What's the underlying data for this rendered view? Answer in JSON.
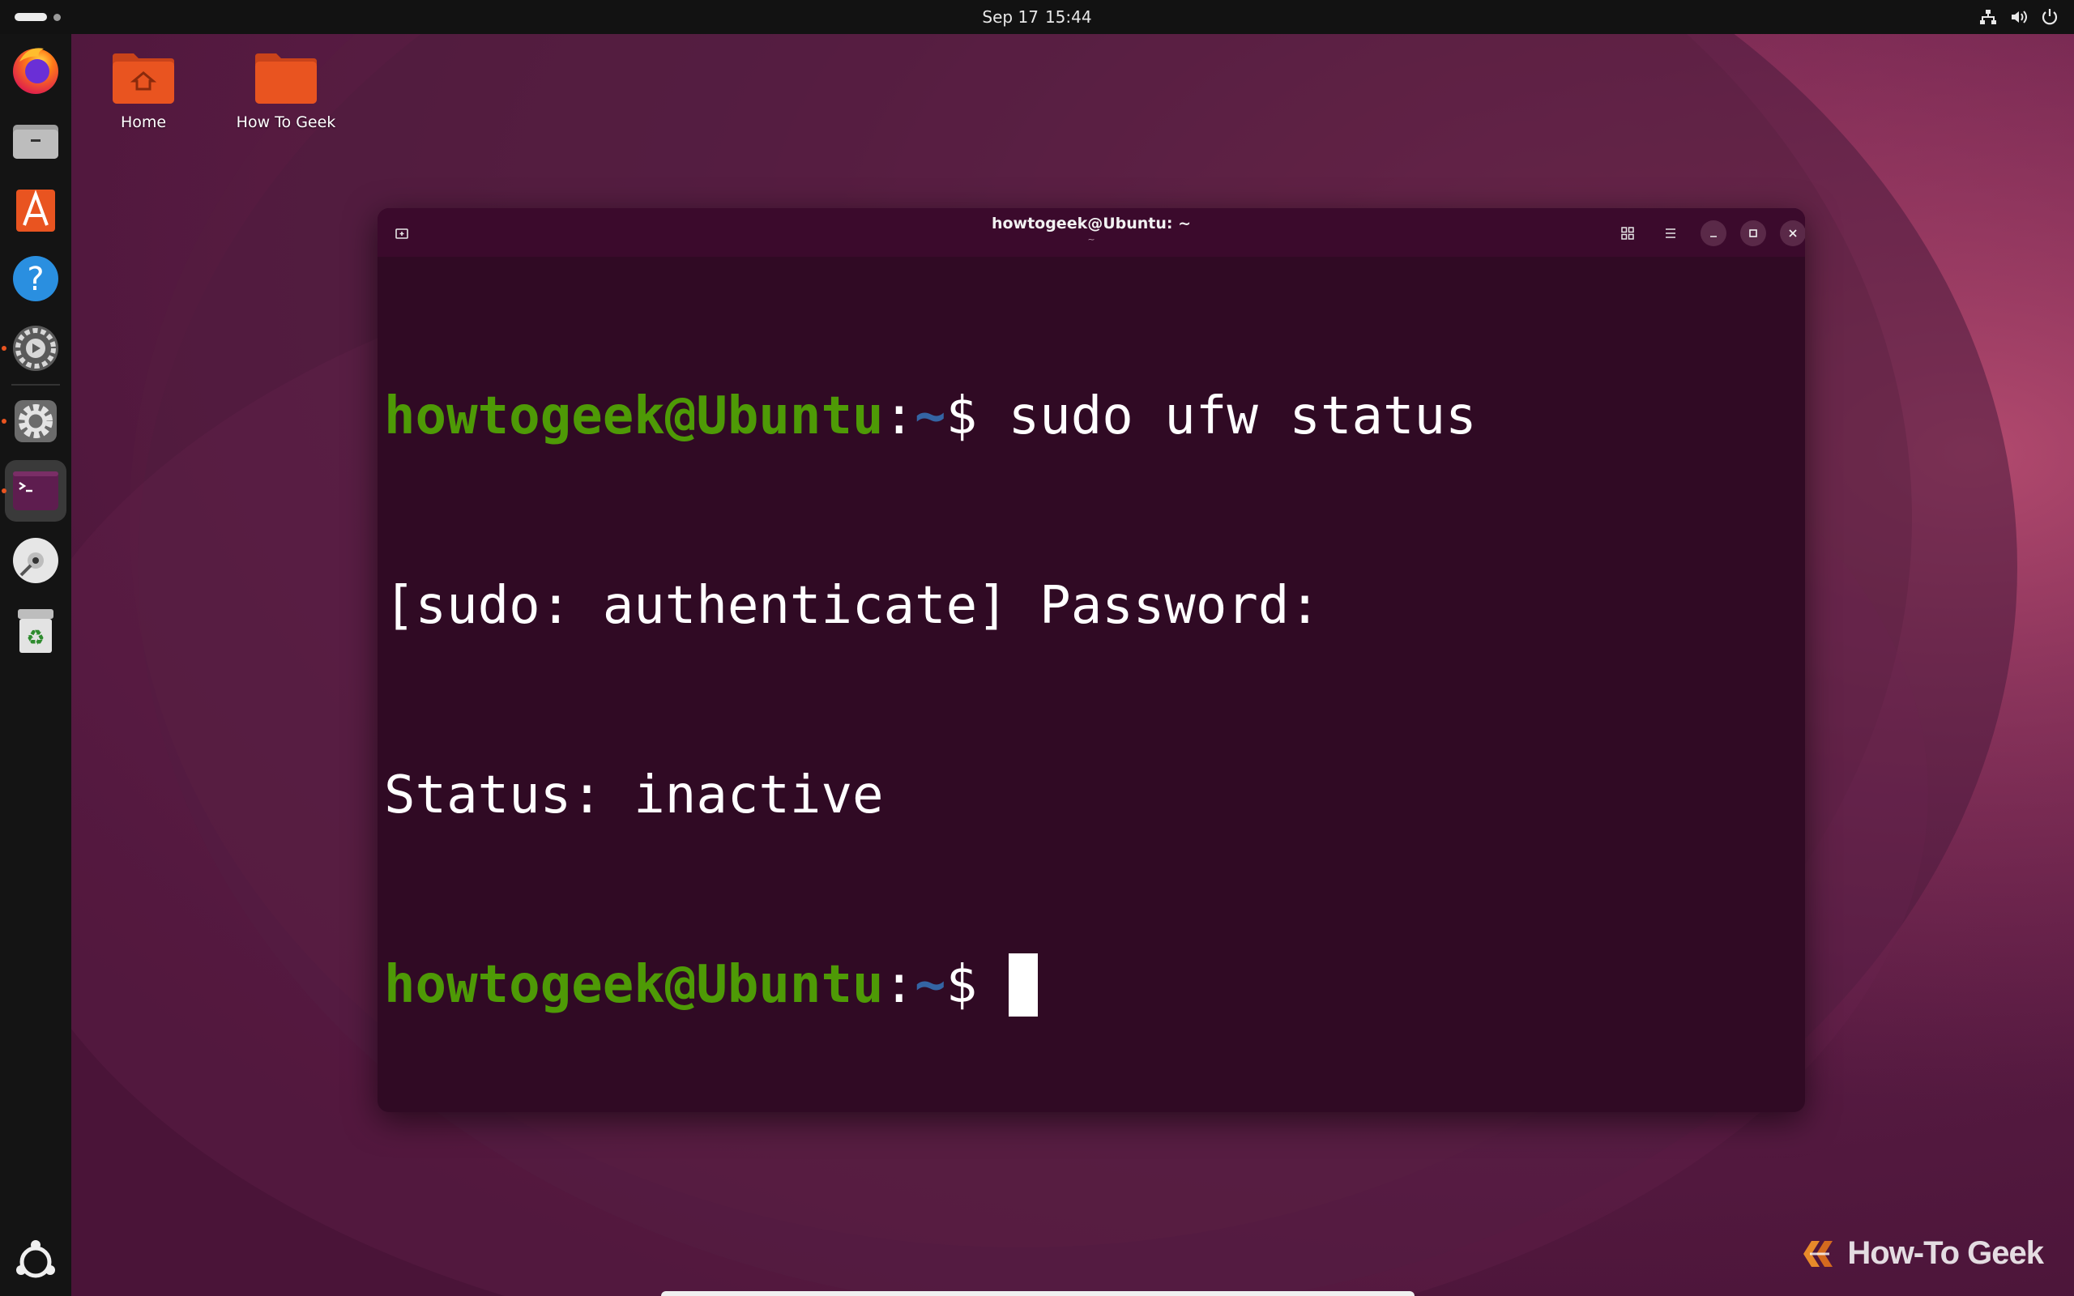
{
  "topbar": {
    "date": "Sep 17",
    "time": "15:44"
  },
  "dock": {
    "items": [
      {
        "name": "firefox",
        "icon": "firefox-icon",
        "running": false
      },
      {
        "name": "files",
        "icon": "folder-icon",
        "running": false
      },
      {
        "name": "app-center",
        "icon": "app-center-icon",
        "running": false
      },
      {
        "name": "help",
        "icon": "help-icon",
        "running": false
      },
      {
        "name": "software-updater",
        "icon": "updater-icon",
        "running": true
      },
      {
        "name": "settings",
        "icon": "gear-icon",
        "running": true
      },
      {
        "name": "terminal",
        "icon": "terminal-icon",
        "running": true,
        "active": true
      },
      {
        "name": "disc",
        "icon": "disc-icon",
        "running": false
      },
      {
        "name": "trash",
        "icon": "trash-icon",
        "running": false
      },
      {
        "name": "show-apps",
        "icon": "ubuntu-logo-icon",
        "running": false
      }
    ]
  },
  "desktop": {
    "icons": [
      {
        "label": "Home",
        "icon": "home-folder-icon"
      },
      {
        "label": "How To Geek",
        "icon": "folder-icon"
      }
    ]
  },
  "terminal": {
    "title": "howtogeek@Ubuntu: ~",
    "subtitle": "~",
    "lines": [
      {
        "user": "howtogeek@Ubuntu",
        "sep": ":",
        "path": "~",
        "dollar": "$ ",
        "cmd": "sudo ufw status"
      },
      {
        "text": "[sudo: authenticate] Password:"
      },
      {
        "text": "Status: inactive"
      },
      {
        "user": "howtogeek@Ubuntu",
        "sep": ":",
        "path": "~",
        "dollar": "$ ",
        "cmd": ""
      }
    ]
  },
  "watermark": {
    "text": "How-To Geek"
  },
  "colors": {
    "prompt_user": "#4e9a06",
    "prompt_path": "#3465a4",
    "terminal_bg": "#300a24",
    "ubuntu_orange": "#e95420"
  }
}
